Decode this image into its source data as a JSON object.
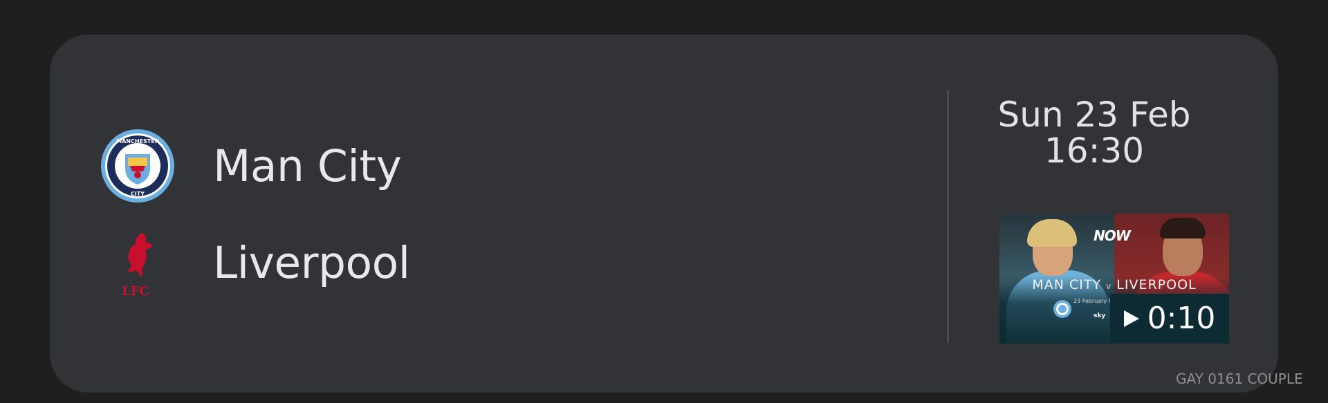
{
  "match": {
    "home_team": {
      "name": "Man City",
      "crest_icon": "manchester-city-crest-icon",
      "crest_text_top": "MANCHESTER",
      "crest_text_bottom": "CITY",
      "crest_color": "#6caee0"
    },
    "away_team": {
      "name": "Liverpool",
      "crest_icon": "liverpool-liverbird-crest-icon",
      "crest_text": "LFC",
      "crest_color": "#c8102e"
    },
    "date": "Sun 23 Feb",
    "time": "16:30"
  },
  "video": {
    "thumbnail_brand": "NOW",
    "thumbnail_home": "MAN CITY",
    "thumbnail_vs": "v",
    "thumbnail_away": "LIVERPOOL",
    "thumbnail_subline": "23 February from 4.30pm",
    "thumbnail_channel": "sky",
    "play_icon": "play-icon",
    "duration": "0:10"
  },
  "watermark": "GAY 0161 COUPLE",
  "colors": {
    "page_background": "#1f1f1f",
    "card_background": "#323337",
    "text_primary": "#e9e9ec",
    "divider": "#4a4b50"
  }
}
